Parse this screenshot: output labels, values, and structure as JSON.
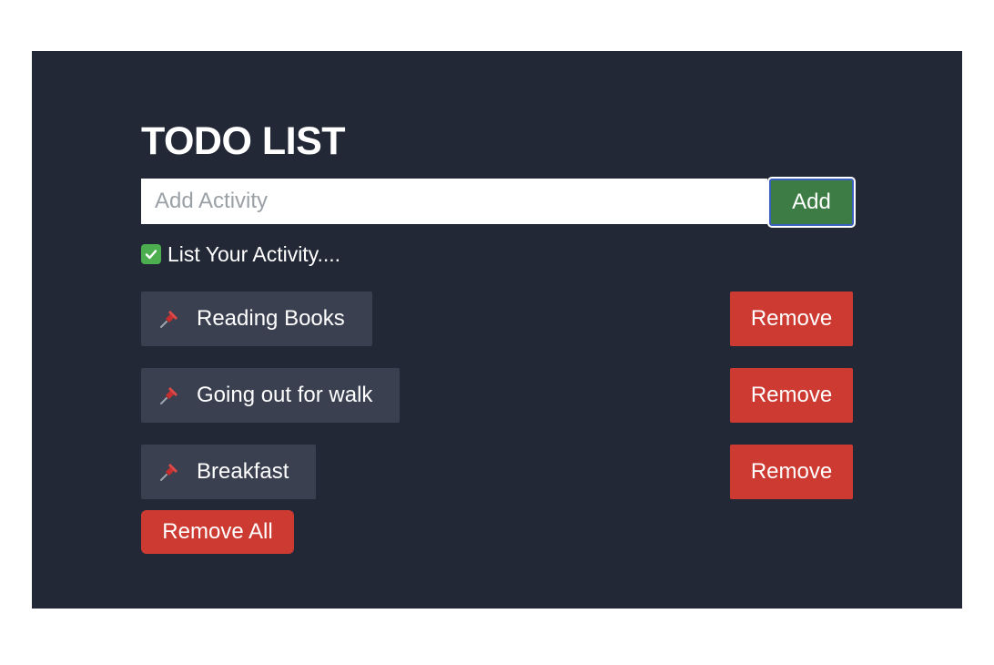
{
  "app": {
    "title": "TODO LIST"
  },
  "input": {
    "placeholder": "Add Activity",
    "value": ""
  },
  "add_button": {
    "label": "Add"
  },
  "hint": {
    "text": "List Your Activity....",
    "icon": "check-mark-icon"
  },
  "tasks": [
    {
      "label": "Reading Books",
      "icon": "pushpin-icon",
      "remove_label": "Remove"
    },
    {
      "label": "Going out for walk",
      "icon": "pushpin-icon",
      "remove_label": "Remove"
    },
    {
      "label": "Breakfast",
      "icon": "pushpin-icon",
      "remove_label": "Remove"
    }
  ],
  "remove_all": {
    "label": "Remove All"
  },
  "colors": {
    "panel_background": "#232836",
    "task_background": "#3a4050",
    "add_button": "#3d7d45",
    "remove_button": "#cc3a32",
    "check_icon": "#4cae4f"
  }
}
